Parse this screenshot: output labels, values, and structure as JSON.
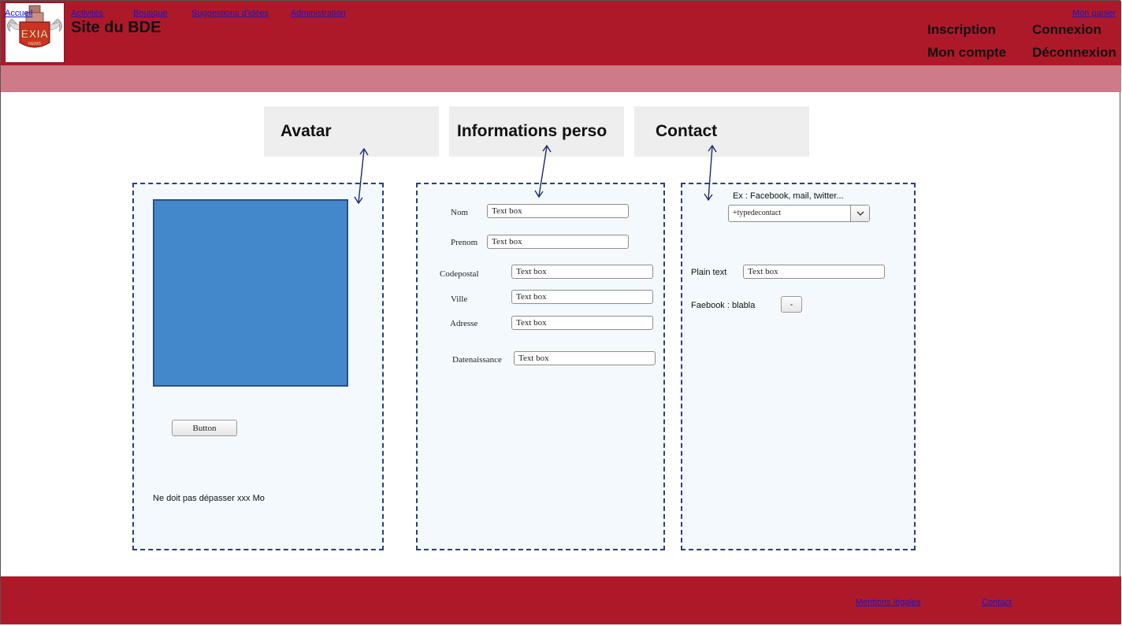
{
  "header": {
    "site_title": "Site du BDE",
    "logo_text": "EXIA",
    "logo_subtext": "REIMS",
    "links": {
      "inscription": "Inscription",
      "connexion": "Connexion",
      "mon_compte": "Mon compte",
      "deconnexion": "Déconnexion"
    }
  },
  "nav": {
    "items": [
      "Accueil",
      "Activités",
      "Boutique",
      "Suggestions d'idées",
      "Administration"
    ],
    "cart": "Mon panier"
  },
  "tabs": [
    "Avatar",
    "Informations perso",
    "Contact"
  ],
  "avatar": {
    "button_label": "Button",
    "note": "Ne doit pas dépasser xxx Mo"
  },
  "info": {
    "fields": [
      {
        "label": "Nom",
        "value": "Text box"
      },
      {
        "label": "Prenom",
        "value": "Text box"
      },
      {
        "label": "Codepostal",
        "value": "Text box"
      },
      {
        "label": "Ville",
        "value": "Text box"
      },
      {
        "label": "Adresse",
        "value": "Text box"
      },
      {
        "label": "Datenaissance",
        "value": "Text box"
      }
    ]
  },
  "contact": {
    "hint": "Ex : Facebook, mail, twitter...",
    "select_value": "+typedecontact",
    "plain_label": "Plain text",
    "plain_value": "Text box",
    "entry": "Faebook : blabla",
    "remove_label": "-"
  },
  "footer": {
    "links": [
      "Mentions légales",
      "Contact"
    ]
  },
  "colors": {
    "header_bg": "#ae192a",
    "nav_bg": "#cd7a89",
    "avatar_fill": "#4488cc",
    "link": "#1515cc"
  }
}
